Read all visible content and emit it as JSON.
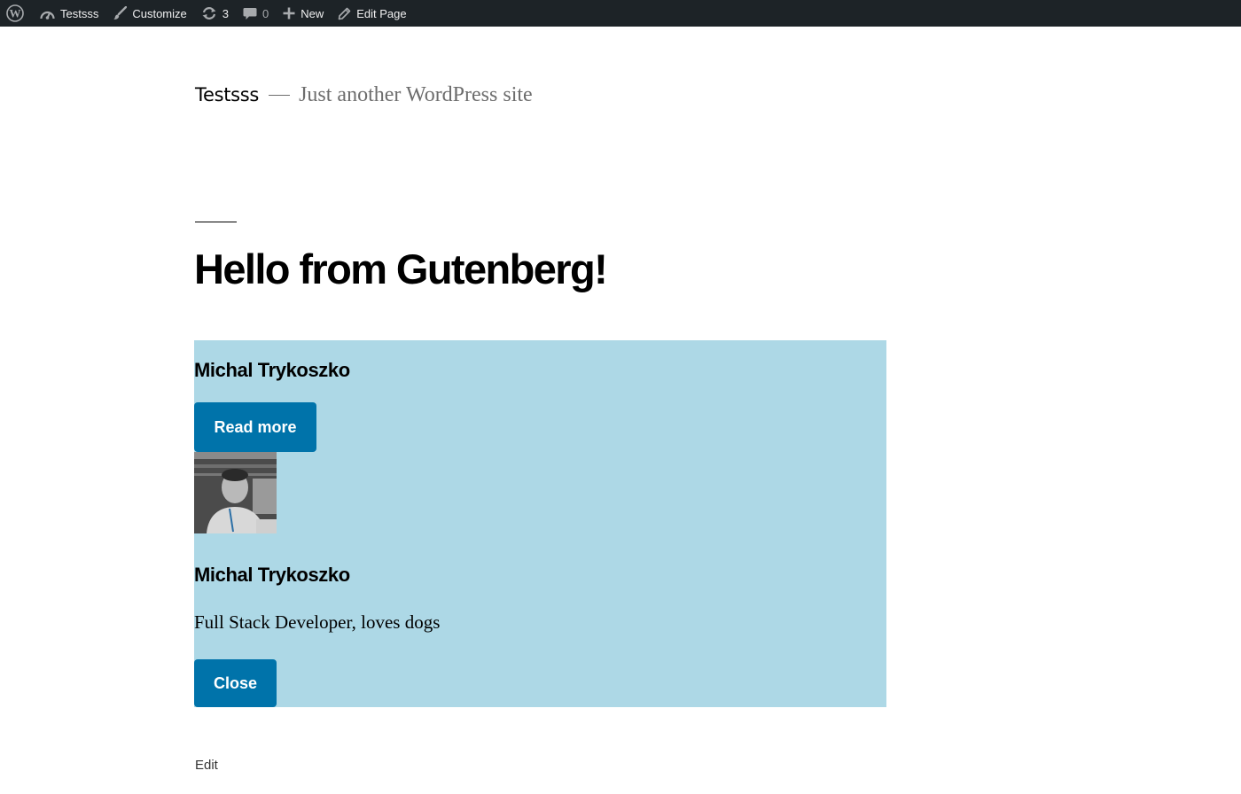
{
  "admin_bar": {
    "site_name": "Testsss",
    "customize": "Customize",
    "updates_count": "3",
    "comments_count": "0",
    "new_label": "New",
    "edit_page": "Edit Page"
  },
  "site": {
    "title": "Testsss",
    "description": "Just another WordPress site"
  },
  "page": {
    "title": "Hello from Gutenberg!",
    "edit_label": "Edit"
  },
  "card": {
    "name_top": "Michal Trykoszko",
    "read_more": "Read more",
    "name_bottom": "Michal Trykoszko",
    "bio": "Full Stack Developer, loves dogs",
    "close": "Close"
  },
  "colors": {
    "admin_bar_bg": "#1d2327",
    "card_bg": "#add8e6",
    "button_bg": "#0073aa"
  }
}
